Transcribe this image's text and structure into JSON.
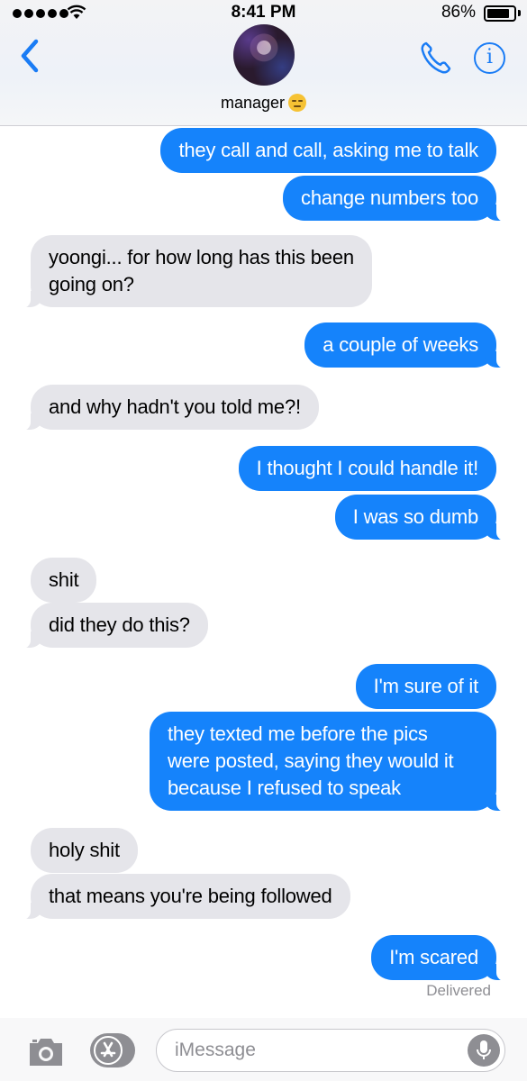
{
  "status_bar": {
    "time": "8:41 PM",
    "battery": "86%",
    "battery_level": 0.86
  },
  "header": {
    "contact_name": "manager"
  },
  "messages": [
    {
      "text": "they call and call, asking me to talk",
      "from": "me"
    },
    {
      "text": "change numbers too",
      "from": "me"
    },
    {
      "text": "yoongi... for how long has this been\ngoing on?",
      "from": "them"
    },
    {
      "text": "a couple of weeks",
      "from": "me"
    },
    {
      "text": "and why hadn't you told me?!",
      "from": "them"
    },
    {
      "text": "I thought I could handle it!",
      "from": "me"
    },
    {
      "text": "I was so dumb",
      "from": "me"
    },
    {
      "text": "shit",
      "from": "them"
    },
    {
      "text": "did they do this?",
      "from": "them"
    },
    {
      "text": "I'm sure of it",
      "from": "me"
    },
    {
      "text": "they texted me before the pics\nwere posted, saying they would it\nbecause I refused to speak",
      "from": "me"
    },
    {
      "text": "holy shit",
      "from": "them"
    },
    {
      "text": "that means you're being followed",
      "from": "them"
    },
    {
      "text": "I'm scared",
      "from": "me"
    }
  ],
  "delivery_status": "Delivered",
  "input": {
    "placeholder": "iMessage",
    "value": ""
  },
  "icons": {
    "back": "chevron-left-icon",
    "phone": "phone-icon",
    "info": "info-icon",
    "camera": "camera-icon",
    "apps": "app-store-icon",
    "mic": "microphone-icon"
  },
  "colors": {
    "sent_bubble": "#1583fb",
    "received_bubble": "#e5e5ea",
    "accent": "#1a7cf5"
  }
}
